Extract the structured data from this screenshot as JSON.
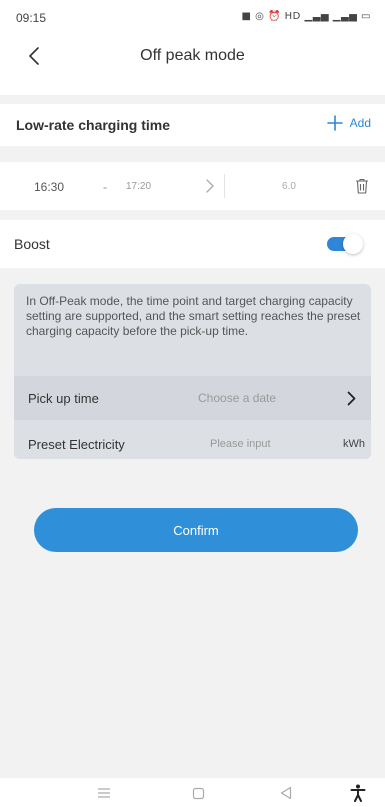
{
  "status_bar": {
    "time": "09:15",
    "icons_text": "■ ◎ ⏰ HD ▁▃▅ ▁▃▅ ▭"
  },
  "header": {
    "title": "Off peak mode",
    "back_icon": "chevron-left-icon"
  },
  "charging_section": {
    "title": "Low-rate charging time",
    "add_label": "Add",
    "add_icon": "plus-icon",
    "accent_color": "#2f86d6"
  },
  "time_slot": {
    "start": "16:30",
    "separator": "-",
    "end": "17:20",
    "value": "6.0",
    "trash_icon": "trash-icon"
  },
  "boost": {
    "label": "Boost",
    "enabled": true
  },
  "info_card": {
    "description": "In Off-Peak mode, the time point and target charging capacity setting are supported, and the smart setting reaches the preset charging capacity before the pick-up time.",
    "pickup": {
      "label": "Pick up time",
      "placeholder": "Choose a date"
    },
    "electricity": {
      "label": "Preset Electricity",
      "placeholder": "Please input",
      "unit": "kWh"
    }
  },
  "confirm": {
    "label": "Confirm",
    "color": "#2f8fd8"
  },
  "system_nav": {
    "icons": [
      "menu-icon",
      "home-icon",
      "back-icon",
      "accessibility-icon"
    ]
  }
}
